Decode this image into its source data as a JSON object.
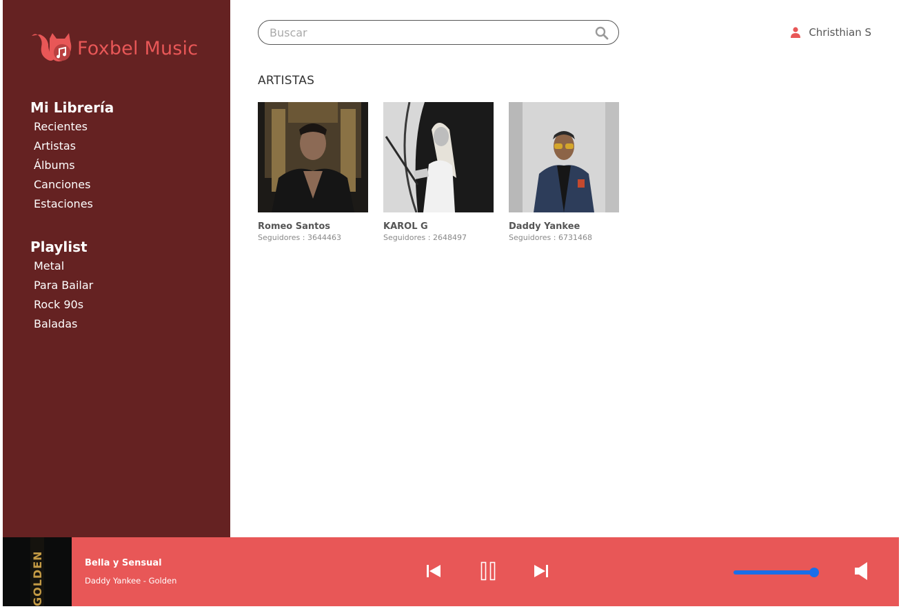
{
  "brand": {
    "name": "Foxbel Music"
  },
  "sidebar": {
    "library_title": "Mi Librería",
    "library_items": [
      "Recientes",
      "Artistas",
      "Álbums",
      "Canciones",
      "Estaciones"
    ],
    "playlist_title": "Playlist",
    "playlist_items": [
      "Metal",
      "Para Bailar",
      "Rock 90s",
      "Baladas"
    ]
  },
  "search": {
    "placeholder": "Buscar",
    "value": ""
  },
  "user": {
    "name": "Christhian S"
  },
  "main": {
    "title": "ARTISTAS",
    "artists": [
      {
        "name": "Romeo Santos",
        "followers": "Seguidores : 3644463"
      },
      {
        "name": "KAROL G",
        "followers": "Seguidores : 2648497"
      },
      {
        "name": "Daddy Yankee",
        "followers": "Seguidores : 6731468"
      }
    ]
  },
  "player": {
    "cover_text": "GOLDEN",
    "track_title": "Bella y Sensual",
    "track_artist": "Daddy Yankee - Golden",
    "volume": 1.0,
    "icons": {
      "prev": "skip-previous-icon",
      "pause": "pause-icon",
      "next": "skip-next-icon",
      "volume": "speaker-icon"
    }
  },
  "colors": {
    "sidebar_bg": "#652222",
    "accent": "#e85757",
    "player_bg": "#e85757",
    "volume": "#1a6ee8"
  }
}
